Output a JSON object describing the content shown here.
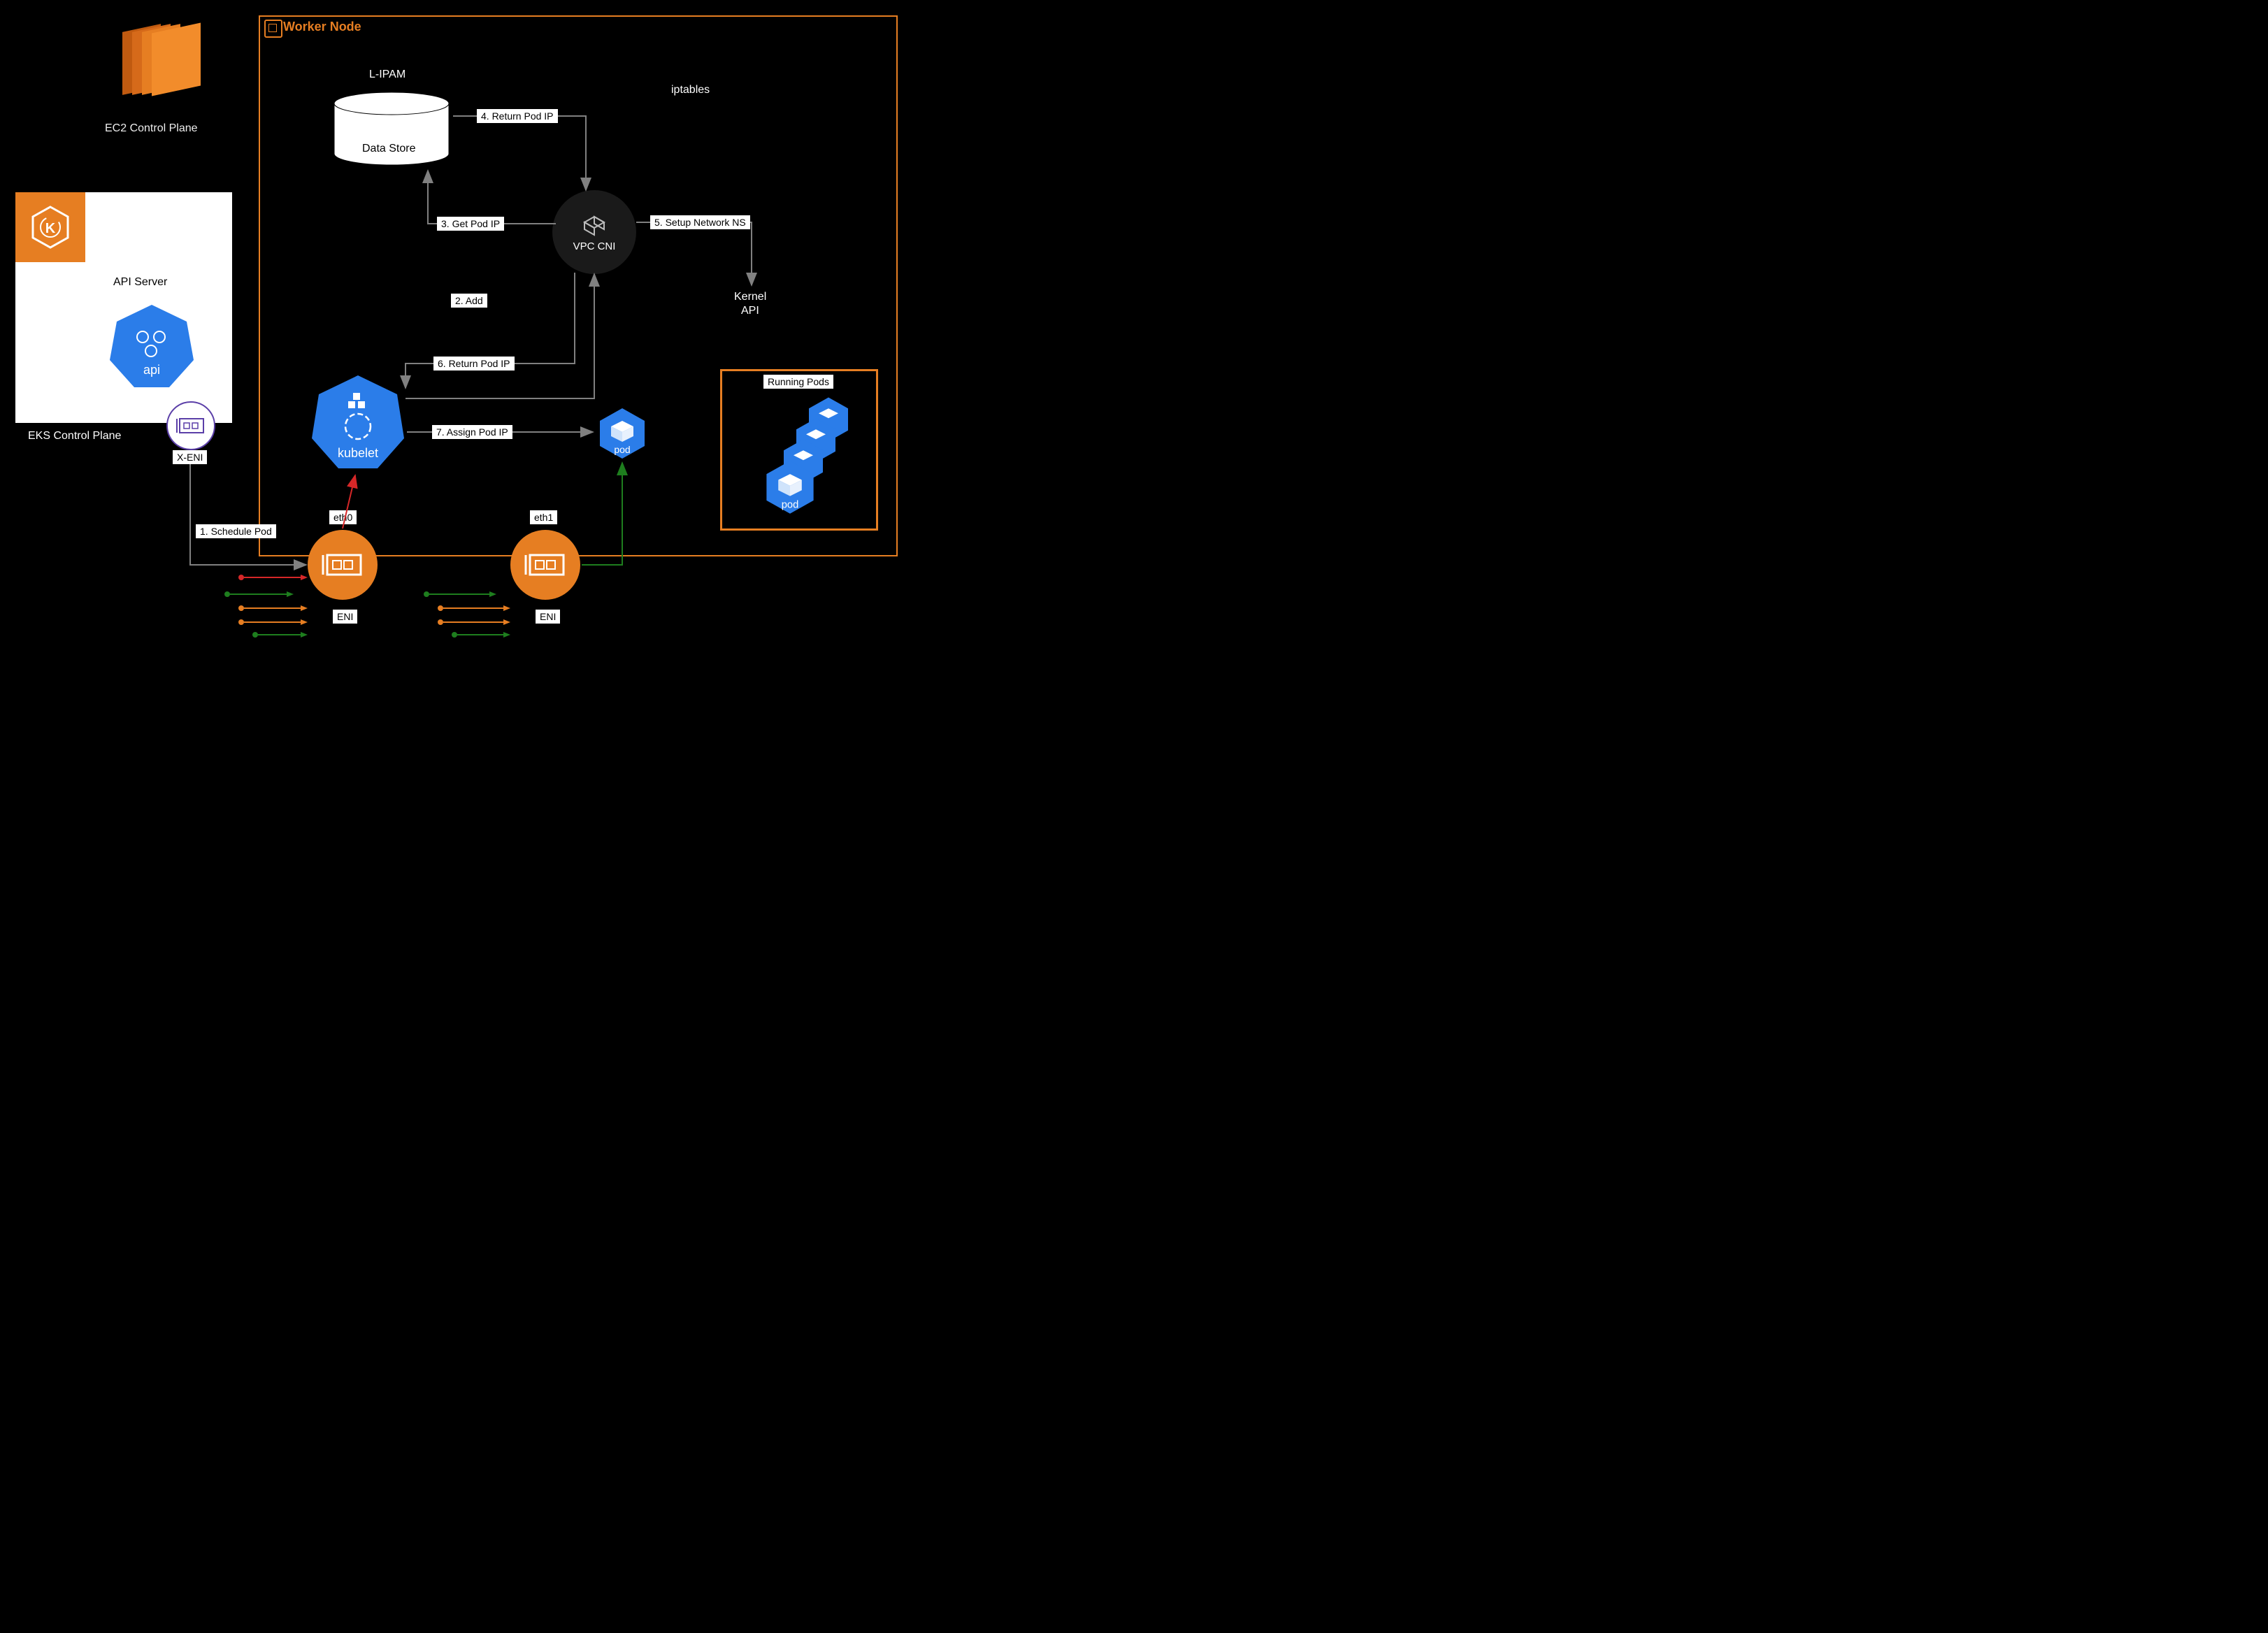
{
  "worker_node": "Worker Node",
  "ec2_label": "EC2 Control Plane",
  "eks_label": "EKS Control Plane",
  "api_server": "API Server",
  "xeni": "X-ENI",
  "lipam": "L-IPAM",
  "data_store": "Data Store",
  "iptables": "iptables",
  "vpc_cni": "VPC CNI",
  "kernel_api_1": "Kernel",
  "kernel_api_2": "API",
  "kubelet": "kubelet",
  "api_text": "api",
  "eth0": "eth0",
  "eth1": "eth1",
  "eni": "ENI",
  "pod": "pod",
  "running_pods": "Running Pods",
  "steps": {
    "s1": "1. Schedule Pod",
    "s2": "2. Add",
    "s3": "3. Get Pod IP",
    "s4": "4. Return Pod IP",
    "s5": "5. Setup Network NS",
    "s6": "6.  Return Pod IP",
    "s7": "7.  Assign Pod IP"
  },
  "colors": {
    "orange": "#e67e22",
    "blue": "#2b7de9",
    "green": "#1e7e1e",
    "red": "#d62728",
    "gray": "#808080"
  }
}
